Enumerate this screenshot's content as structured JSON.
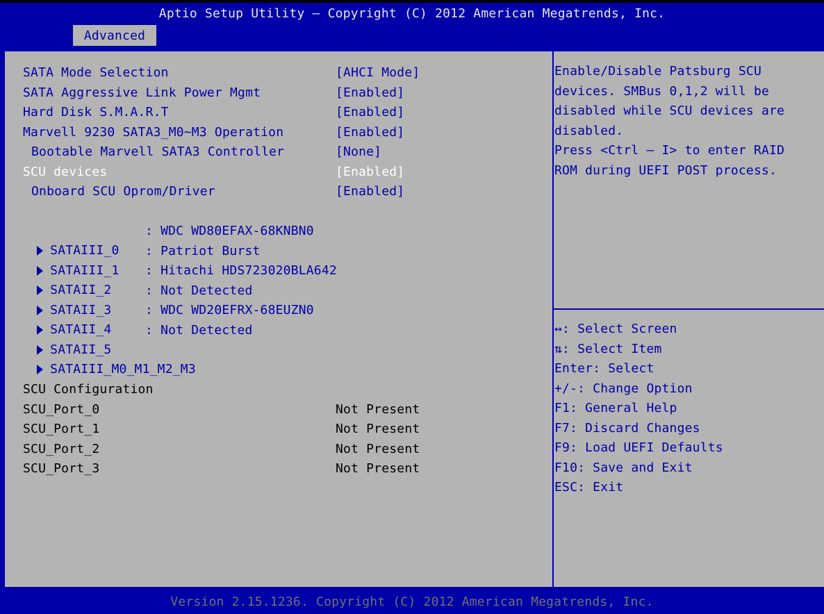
{
  "header": {
    "title": "Aptio Setup Utility – Copyright (C) 2012 American Megatrends, Inc.",
    "active_tab": "Advanced"
  },
  "settings": [
    {
      "label": "SATA Mode Selection",
      "value": "[AHCI Mode]"
    },
    {
      "label": "SATA Aggressive Link Power Mgmt",
      "value": "[Enabled]"
    },
    {
      "label": "Hard Disk S.M.A.R.T",
      "value": "[Enabled]"
    },
    {
      "label": "Marvell 9230 SATA3_M0~M3 Operation",
      "value": "[Enabled]"
    },
    {
      "label": "Bootable Marvell SATA3 Controller",
      "value": "[None]"
    },
    {
      "label": "SCU devices",
      "value": "[Enabled]"
    },
    {
      "label": "Onboard SCU Oprom/Driver",
      "value": "[Enabled]"
    }
  ],
  "ports": [
    {
      "name": "SATAIII_0",
      "device": ": WDC WD80EFAX-68KNBN0"
    },
    {
      "name": "SATAIII_1",
      "device": ": Patriot Burst"
    },
    {
      "name": "SATAII_2",
      "device": ": Hitachi HDS723020BLA642"
    },
    {
      "name": "SATAII_3",
      "device": ": Not Detected"
    },
    {
      "name": "SATAII_4",
      "device": ": WDC WD20EFRX-68EUZN0"
    },
    {
      "name": "SATAII_5",
      "device": ": Not Detected"
    },
    {
      "name": "SATAIII_M0_M1_M2_M3",
      "device": ""
    }
  ],
  "scu": {
    "heading": "SCU Configuration",
    "ports": [
      {
        "label": "SCU_Port_0",
        "value": "Not Present"
      },
      {
        "label": "SCU_Port_1",
        "value": "Not Present"
      },
      {
        "label": "SCU_Port_2",
        "value": "Not Present"
      },
      {
        "label": "SCU_Port_3",
        "value": "Not Present"
      }
    ]
  },
  "help": [
    "Enable/Disable Patsburg SCU",
    "devices. SMBus 0,1,2 will be",
    "disabled while SCU devices are",
    "disabled.",
    "Press <Ctrl – I> to enter RAID",
    "ROM during UEFI POST process."
  ],
  "keys": [
    "↔: Select Screen",
    "⇅: Select Item",
    "Enter: Select",
    "+/-: Change Option",
    "F1: General Help",
    "F7: Discard Changes",
    "F9: Load UEFI Defaults",
    "F10: Save and Exit",
    "ESC: Exit"
  ],
  "footer": "Version 2.15.1236. Copyright (C) 2012 American Megatrends, Inc.",
  "colors": {
    "blue": "#0000a8",
    "grey": "#b4b4b4",
    "selected": "#ffffff"
  }
}
